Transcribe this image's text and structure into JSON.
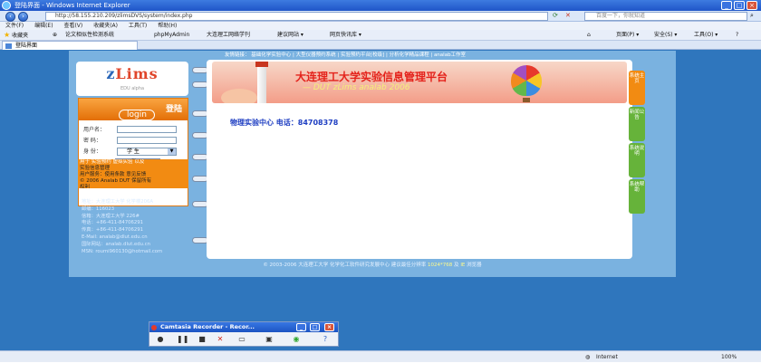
{
  "window": {
    "title": "登陆界面 - Windows Internet Explorer"
  },
  "address": {
    "url": "http://58.155.210.209/zlimsDVS/system/index.php",
    "search_placeholder": "百度一下，你就知道"
  },
  "menu": [
    "文件(F)",
    "编辑(E)",
    "查看(V)",
    "收藏夹(A)",
    "工具(T)",
    "帮助(H)"
  ],
  "favorites": {
    "label": "收藏夹",
    "items": [
      "论文相似性检测系统",
      "phpMyAdmin",
      "大连理工网络学刊",
      "建议网站 ▾",
      "网页快讯库 ▾"
    ]
  },
  "toolbar_right": [
    "页面(P) ▾",
    "安全(S) ▾",
    "工具(O) ▾"
  ],
  "tab": {
    "label": "登陆界面"
  },
  "friend_links": "友情链接：  基础化学实验中心  |  大型仪器预约系统  |  实验预约平台[校级]  |  分析化学精品课程  |  analab工作室",
  "logo": {
    "brand_a": "z",
    "brand_b": "Lims",
    "sub": "EDU  alpha"
  },
  "login": {
    "title": "登陆",
    "subtitle": "login",
    "username_label": "用户名：",
    "password_label": "密    码：",
    "role_label": "身    份：",
    "role_value": "学    生",
    "submit": "登  录"
  },
  "notes": {
    "line1a": "用于  实验预约  虚拟实验  以及",
    "line2": "实验信息管理",
    "line3": "用户服务：使用条款  意见反馈",
    "line4": "© 2006 Analab DUT  保留所有",
    "line5": "权利"
  },
  "contact": [
    "地址：大连理工大学 化学楼206A",
    "邮编：116023",
    "信箱：大连理工大学 226#",
    "电话：+86-411-84706291",
    "传真：+86-411-84706291",
    "E-Mail: analab@dlut.edu.cn",
    "国际网站：analab.dlut.edu.cn",
    "MSN: roumi960130@hotmail.com"
  ],
  "banner": {
    "title": "大连理工大学实验信息管理平台",
    "subtitle": "— DUT zLims analab 2006"
  },
  "main": {
    "phone": "物理实验中心  电话：84708378"
  },
  "side_tabs": [
    {
      "label": "系统主页",
      "color": "#f28b12"
    },
    {
      "label": "新闻公告",
      "color": "#66b33a"
    },
    {
      "label": "系统说明",
      "color": "#66b33a"
    },
    {
      "label": "系统帮助",
      "color": "#66b33a"
    }
  ],
  "footer": {
    "text": "© 2003-2006 大连理工大学 化学化工软件研究发展中心 建议最佳分辨率",
    "res": "1024*768",
    "and": "及",
    "ie": "IE",
    "tail": "浏览器"
  },
  "camtasia": {
    "title": "Camtasia Recorder - Recor..."
  },
  "status": {
    "zone": "Internet",
    "zoom": "100%"
  }
}
